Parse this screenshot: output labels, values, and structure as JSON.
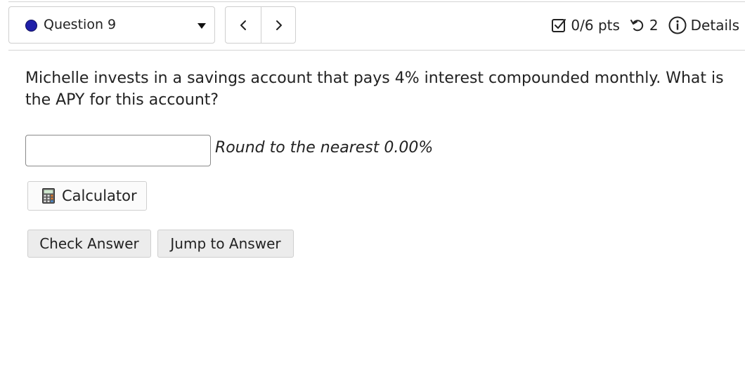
{
  "header": {
    "question_selector": {
      "label": "Question 9"
    },
    "status": {
      "points": "0/6 pts",
      "attempts": "2",
      "details_label": "Details"
    }
  },
  "question": {
    "text": "Michelle invests in a savings account that pays 4% interest compounded monthly. What is the APY for this account?"
  },
  "answer": {
    "value": "",
    "hint": "Round to the nearest 0.00%"
  },
  "buttons": {
    "calculator_label": "Calculator",
    "check_label": "Check Answer",
    "jump_label": "Jump to Answer"
  },
  "colors": {
    "status_dot": "#1f1fa8"
  }
}
